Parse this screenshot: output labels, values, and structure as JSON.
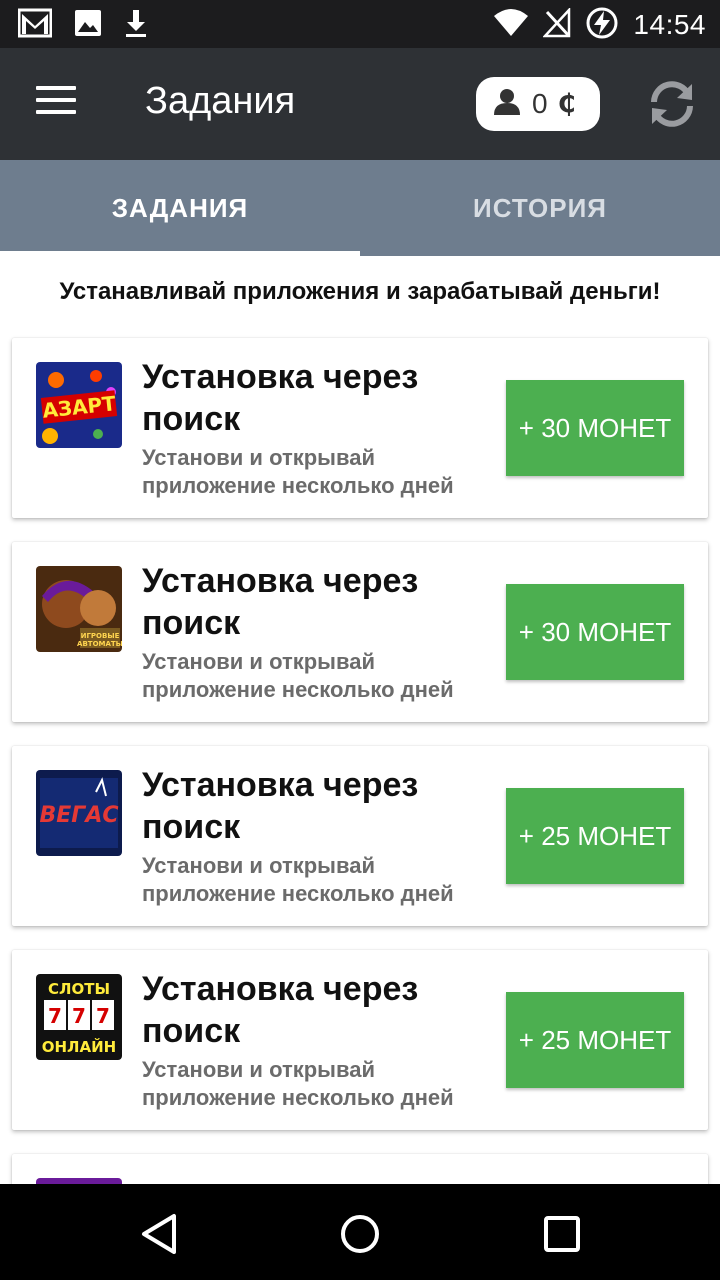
{
  "status_bar": {
    "time": "14:54",
    "left_icons": [
      "gmail-icon",
      "image-icon",
      "download-icon"
    ],
    "right_icons": [
      "wifi-icon",
      "no-signal-icon",
      "battery-charging-icon"
    ]
  },
  "toolbar": {
    "title": "Задания",
    "coins": "0",
    "coin_sign": "₵"
  },
  "tabs": [
    {
      "label": "ЗАДАНИЯ",
      "active": true
    },
    {
      "label": "ИСТОРИЯ",
      "active": false
    }
  ],
  "subtitle": "Устанавливай приложения и зарабатывай деньги!",
  "tasks": [
    {
      "title": "Установка через поиск",
      "description": "Установи и открывай приложение несколько дней",
      "reward": "+ 30 МОНЕТ",
      "icon": "azart-app-icon"
    },
    {
      "title": "Установка через поиск",
      "description": "Установи и открывай приложение несколько дней",
      "reward": "+ 30 МОНЕТ",
      "icon": "slot-character-app-icon"
    },
    {
      "title": "Установка через поиск",
      "description": "Установи и открывай приложение несколько дней",
      "reward": "+ 25 МОНЕТ",
      "icon": "vegas-app-icon"
    },
    {
      "title": "Установка через поиск",
      "description": "Установи и открывай приложение несколько дней",
      "reward": "+ 25 МОНЕТ",
      "icon": "sloty-online-app-icon"
    }
  ],
  "colors": {
    "toolbar_bg": "#2e3135",
    "tabs_bg": "#6e7d8e",
    "reward_green": "#4caf50"
  }
}
